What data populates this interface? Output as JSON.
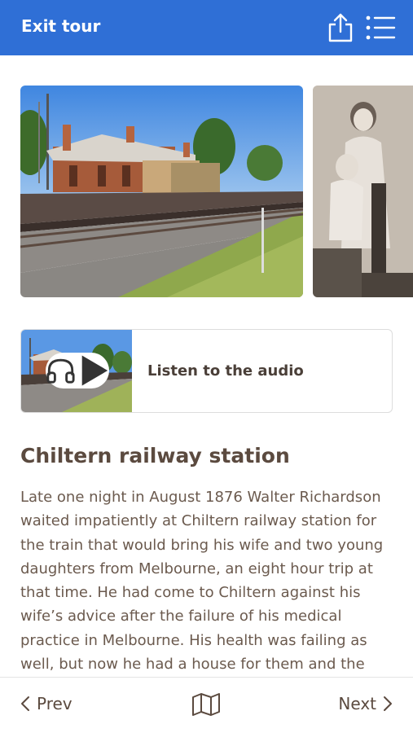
{
  "header": {
    "exit_label": "Exit tour",
    "background": "#2f6fd6"
  },
  "icons": {
    "share": "share-icon",
    "menu": "list-menu-icon",
    "headphones": "headphones-icon",
    "play": "play-icon",
    "map": "map-icon",
    "prev": "chevron-left-icon",
    "next": "chevron-right-icon"
  },
  "gallery": {
    "images": [
      "railway-station-photo",
      "historic-portrait-photo"
    ]
  },
  "audio": {
    "label": "Listen to the audio"
  },
  "content": {
    "title": "Chiltern railway station",
    "body": "Late one night in August 1876 Walter Richardson waited impatiently at Chiltern railway station for the train that would bring his wife and two young daughters from Melbourne, an eight hour trip at that time. He had come to Chiltern against his wife’s advice after the failure of his medical practice in Melbourne. His health was failing as well, but now he had a house for them and the beginnings of a"
  },
  "footer": {
    "prev_label": "Prev",
    "next_label": "Next"
  },
  "colors": {
    "text_brown": "#5b4a3f",
    "border": "#dddddd"
  }
}
